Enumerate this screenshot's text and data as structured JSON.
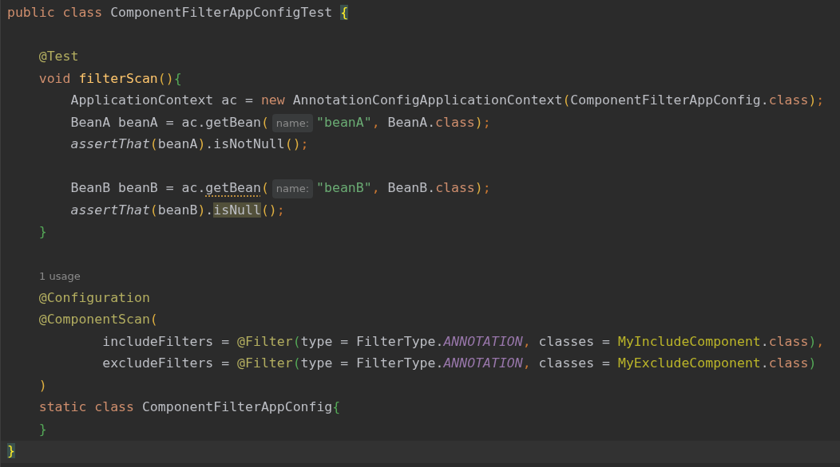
{
  "editor": {
    "lines": [
      {
        "kind": "code",
        "tokens": [
          {
            "kind": "k",
            "text": "public class "
          },
          {
            "kind": "t",
            "text": "ComponentFilterAppConfigTest "
          },
          {
            "kind": "b",
            "text": "{",
            "matched": true
          }
        ]
      },
      {
        "kind": "blank"
      },
      {
        "kind": "code",
        "tokens": [
          {
            "kind": "a",
            "text": "    @Test"
          }
        ]
      },
      {
        "kind": "code",
        "tokens": [
          {
            "kind": "k",
            "text": "    void "
          },
          {
            "kind": "m",
            "text": "filterScan"
          },
          {
            "kind": "p",
            "text": "()"
          },
          {
            "kind": "g",
            "text": "{"
          }
        ]
      },
      {
        "kind": "code",
        "tokens": [
          {
            "kind": "t",
            "text": "        ApplicationContext ac = "
          },
          {
            "kind": "k",
            "text": "new "
          },
          {
            "kind": "t",
            "text": "AnnotationConfigApplicationContext"
          },
          {
            "kind": "p",
            "text": "("
          },
          {
            "kind": "t",
            "text": "ComponentFilterAppConfig."
          },
          {
            "kind": "k",
            "text": "class"
          },
          {
            "kind": "p",
            "text": ")"
          },
          {
            "kind": "o",
            "text": ";"
          }
        ]
      },
      {
        "kind": "code",
        "tokens": [
          {
            "kind": "t",
            "text": "        BeanA beanA = ac.getBean"
          },
          {
            "kind": "p",
            "text": "("
          },
          {
            "kind": "hint",
            "text": "name:"
          },
          {
            "kind": "s",
            "text": "\"beanA\""
          },
          {
            "kind": "o",
            "text": ", "
          },
          {
            "kind": "t",
            "text": "BeanA."
          },
          {
            "kind": "k",
            "text": "class"
          },
          {
            "kind": "p",
            "text": ")"
          },
          {
            "kind": "o",
            "text": ";"
          }
        ]
      },
      {
        "kind": "code",
        "tokens": [
          {
            "kind": "i",
            "text": "        assertThat"
          },
          {
            "kind": "p",
            "text": "("
          },
          {
            "kind": "t",
            "text": "beanA"
          },
          {
            "kind": "p",
            "text": ")"
          },
          {
            "kind": "t",
            "text": ".isNotNull"
          },
          {
            "kind": "p",
            "text": "()"
          },
          {
            "kind": "o",
            "text": ";"
          }
        ]
      },
      {
        "kind": "blank"
      },
      {
        "kind": "code",
        "tokens": [
          {
            "kind": "t",
            "text": "        BeanB beanB = ac."
          },
          {
            "kind": "t",
            "text": "getBean",
            "warning": true
          },
          {
            "kind": "p",
            "text": "("
          },
          {
            "kind": "hint",
            "text": "name:"
          },
          {
            "kind": "s",
            "text": "\"beanB\""
          },
          {
            "kind": "o",
            "text": ", "
          },
          {
            "kind": "t",
            "text": "BeanB."
          },
          {
            "kind": "k",
            "text": "class"
          },
          {
            "kind": "p",
            "text": ")"
          },
          {
            "kind": "o",
            "text": ";"
          }
        ]
      },
      {
        "kind": "code",
        "tokens": [
          {
            "kind": "i",
            "text": "        assertThat"
          },
          {
            "kind": "p",
            "text": "("
          },
          {
            "kind": "t",
            "text": "beanB"
          },
          {
            "kind": "p",
            "text": ")"
          },
          {
            "kind": "t",
            "text": "."
          },
          {
            "kind": "t",
            "text": "isNull",
            "highlighted": true
          },
          {
            "kind": "p",
            "text": "()"
          },
          {
            "kind": "o",
            "text": ";"
          }
        ]
      },
      {
        "kind": "code",
        "tokens": [
          {
            "kind": "g",
            "text": "    }"
          }
        ]
      },
      {
        "kind": "blank"
      },
      {
        "kind": "usage",
        "text": "1 usage"
      },
      {
        "kind": "code",
        "tokens": [
          {
            "kind": "a",
            "text": "    @Configuration"
          }
        ]
      },
      {
        "kind": "code",
        "tokens": [
          {
            "kind": "a",
            "text": "    @ComponentScan"
          },
          {
            "kind": "p",
            "text": "("
          }
        ]
      },
      {
        "kind": "code",
        "tokens": [
          {
            "kind": "t",
            "text": "            includeFilters = "
          },
          {
            "kind": "a",
            "text": "@Filter"
          },
          {
            "kind": "g",
            "text": "("
          },
          {
            "kind": "t",
            "text": "type = FilterType."
          },
          {
            "kind": "c",
            "text": "ANNOTATION"
          },
          {
            "kind": "o",
            "text": ", "
          },
          {
            "kind": "t",
            "text": "classes = "
          },
          {
            "kind": "y",
            "text": "MyIncludeComponent"
          },
          {
            "kind": "t",
            "text": "."
          },
          {
            "kind": "k",
            "text": "class"
          },
          {
            "kind": "g",
            "text": ")"
          },
          {
            "kind": "o",
            "text": ","
          }
        ]
      },
      {
        "kind": "code",
        "tokens": [
          {
            "kind": "t",
            "text": "            excludeFilters = "
          },
          {
            "kind": "a",
            "text": "@Filter"
          },
          {
            "kind": "g",
            "text": "("
          },
          {
            "kind": "t",
            "text": "type = FilterType."
          },
          {
            "kind": "c",
            "text": "ANNOTATION"
          },
          {
            "kind": "o",
            "text": ", "
          },
          {
            "kind": "t",
            "text": "classes = "
          },
          {
            "kind": "y",
            "text": "MyExcludeComponent"
          },
          {
            "kind": "t",
            "text": "."
          },
          {
            "kind": "k",
            "text": "class"
          },
          {
            "kind": "g",
            "text": ")"
          }
        ]
      },
      {
        "kind": "code",
        "tokens": [
          {
            "kind": "p",
            "text": "    )"
          }
        ]
      },
      {
        "kind": "code",
        "tokens": [
          {
            "kind": "k",
            "text": "    static class "
          },
          {
            "kind": "t",
            "text": "ComponentFilterAppConfig"
          },
          {
            "kind": "g",
            "text": "{"
          }
        ]
      },
      {
        "kind": "code",
        "tokens": [
          {
            "kind": "g",
            "text": "    }"
          }
        ]
      },
      {
        "kind": "code",
        "current": true,
        "tokens": [
          {
            "kind": "b",
            "text": "}",
            "matched": true
          }
        ]
      }
    ]
  }
}
